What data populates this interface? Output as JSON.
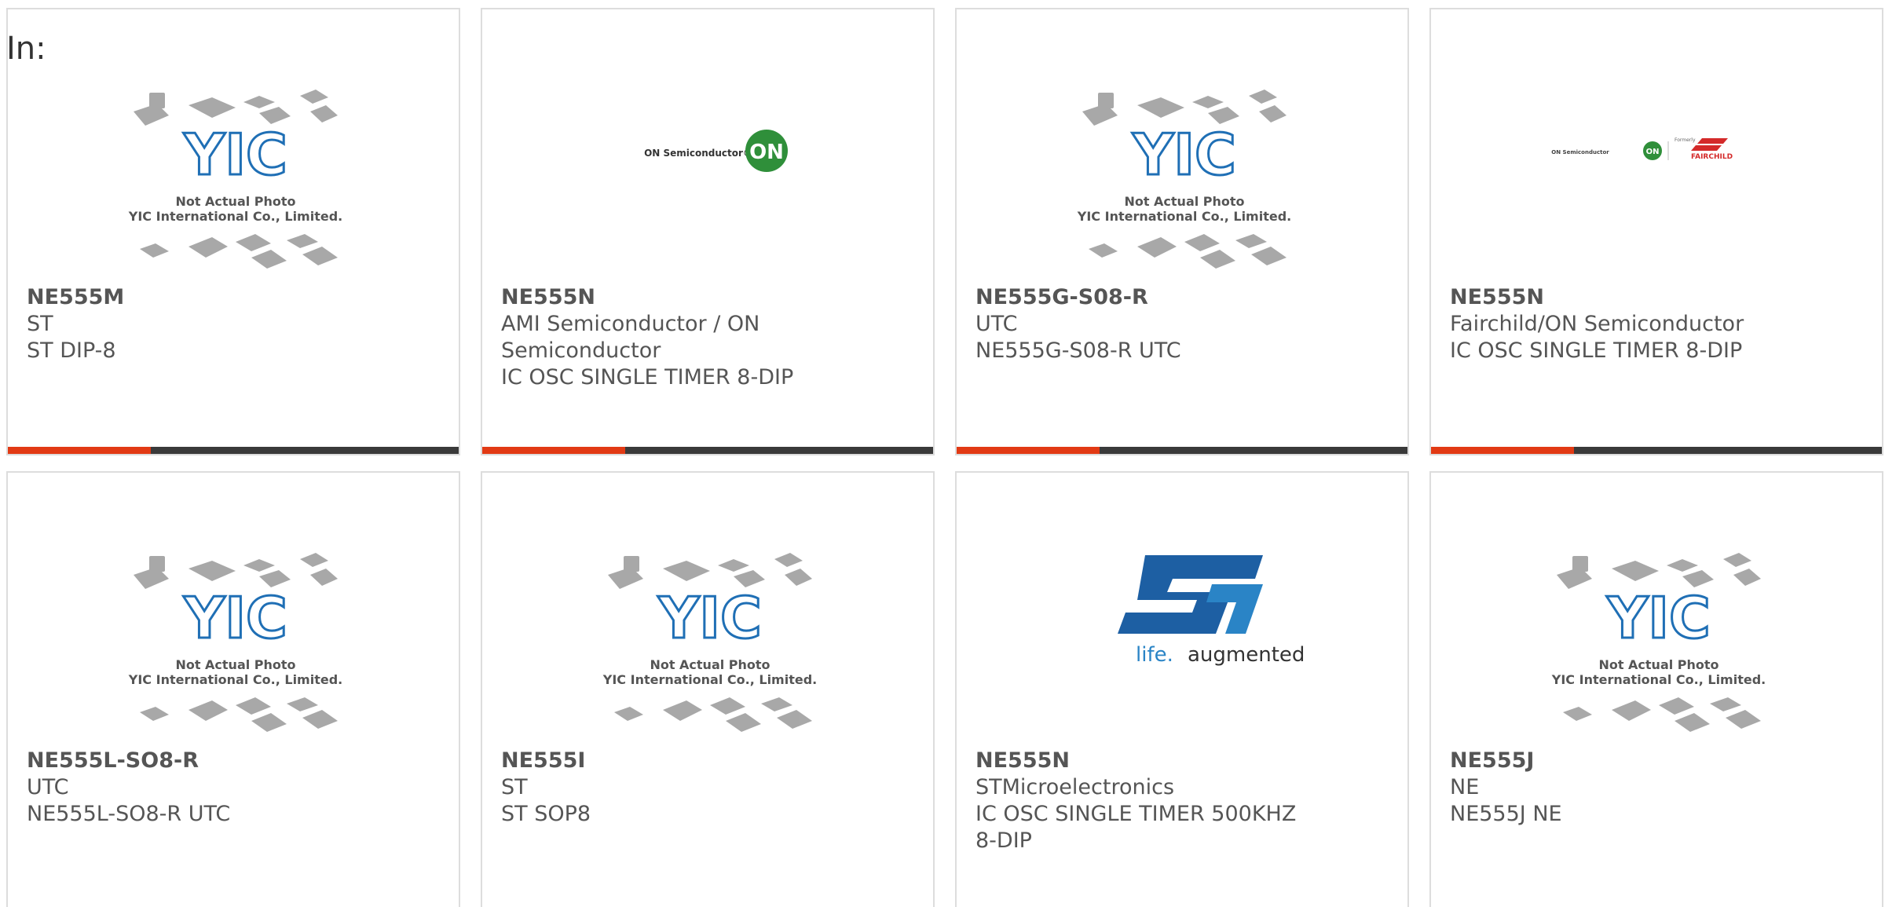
{
  "header": {
    "in_label": "In:"
  },
  "products": [
    {
      "part_number": "NE555M",
      "manufacturer": "ST",
      "description": "ST DIP-8",
      "image": "yic-not-actual-photo",
      "image_text": [
        "Not Actual Photo",
        "YIC International Co., Limited."
      ],
      "logo_text": "YIC"
    },
    {
      "part_number": "NE555N",
      "manufacturer": "AMI Semiconductor / ON Semiconductor",
      "description": "IC OSC SINGLE TIMER 8-DIP",
      "image": "on-semiconductor-logo",
      "logo_text": "ON Semiconductor®",
      "badge_text": "ON"
    },
    {
      "part_number": "NE555G-S08-R",
      "manufacturer": "UTC",
      "description": "NE555G-S08-R UTC",
      "image": "yic-not-actual-photo",
      "image_text": [
        "Not Actual Photo",
        "YIC International Co., Limited."
      ],
      "logo_text": "YIC"
    },
    {
      "part_number": "NE555N",
      "manufacturer": "Fairchild/ON Semiconductor",
      "description": "IC OSC SINGLE TIMER 8-DIP",
      "image": "on-fairchild-logo",
      "logo_text": "ON Semiconductor",
      "badge_text": "ON",
      "formerly_text": "Formerly",
      "fairchild_text": "FAIRCHILD"
    },
    {
      "part_number": "NE555L-SO8-R",
      "manufacturer": "UTC",
      "description": "NE555L-SO8-R UTC",
      "image": "yic-not-actual-photo",
      "image_text": [
        "Not Actual Photo",
        "YIC International Co., Limited."
      ],
      "logo_text": "YIC"
    },
    {
      "part_number": "NE555I",
      "manufacturer": "ST",
      "description": "ST SOP8",
      "image": "yic-not-actual-photo",
      "image_text": [
        "Not Actual Photo",
        "YIC International Co., Limited."
      ],
      "logo_text": "YIC"
    },
    {
      "part_number": "NE555N",
      "manufacturer": "STMicroelectronics",
      "description": "IC OSC SINGLE TIMER 500KHZ 8-DIP",
      "image": "st-life-augmented-logo",
      "logo_text": "ST",
      "tagline_prefix": "life.",
      "tagline_suffix": "augmented"
    },
    {
      "part_number": "NE555J",
      "manufacturer": "NE",
      "description": "NE555J NE",
      "image": "yic-not-actual-photo",
      "image_text": [
        "Not Actual Photo",
        "YIC International Co., Limited."
      ],
      "logo_text": "YIC"
    }
  ],
  "colors": {
    "accent": "#e23a14",
    "bar_dark": "#3a3a3a",
    "text": "#555555",
    "border": "#dddddd",
    "yic_blue": "#1f6fb5",
    "on_green": "#2f8f3a",
    "st_blue": "#1d5fa3"
  }
}
